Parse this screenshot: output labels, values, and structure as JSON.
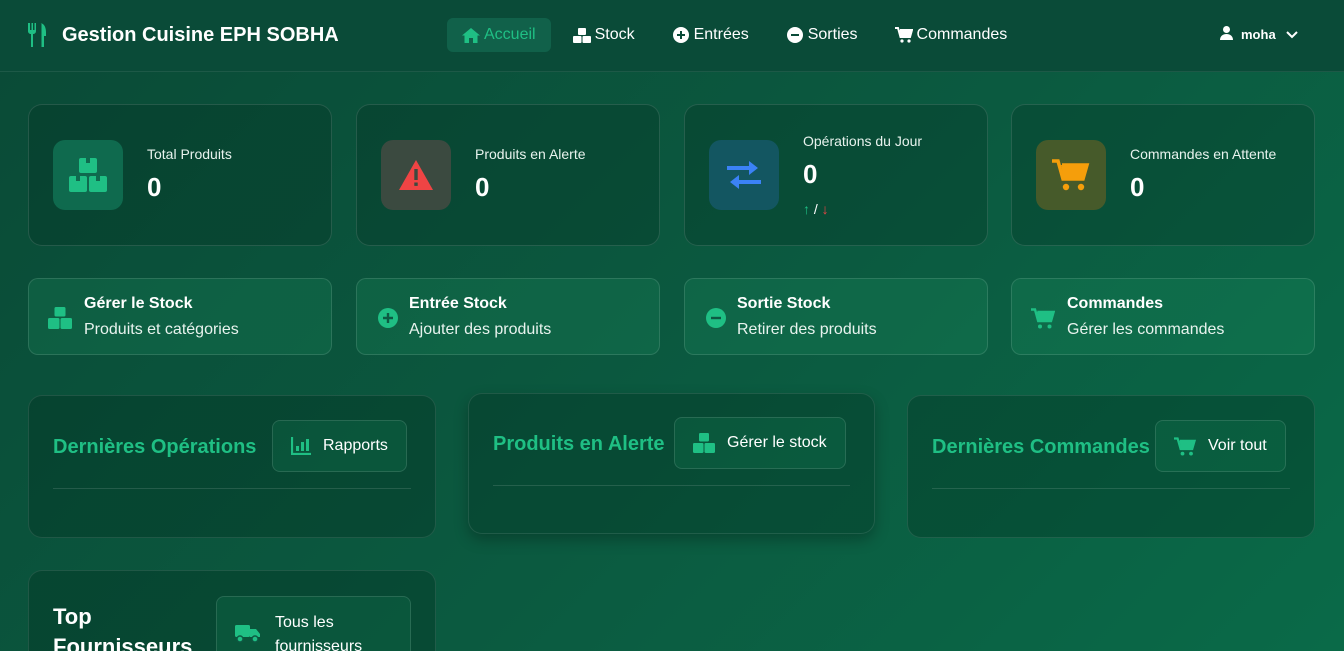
{
  "navbar": {
    "brand_title": "Gestion Cuisine EPH SOBHA",
    "links": [
      {
        "label": "Accueil",
        "icon": "home-icon",
        "active": true
      },
      {
        "label": "Stock",
        "icon": "boxes-icon"
      },
      {
        "label": "Entrées",
        "icon": "plus-circle-icon"
      },
      {
        "label": "Sorties",
        "icon": "minus-circle-icon"
      },
      {
        "label": "Commandes",
        "icon": "cart-icon"
      }
    ],
    "user": {
      "name": "moha",
      "icon": "user-icon"
    }
  },
  "stats": [
    {
      "label": "Total Produits",
      "value": "0",
      "icon": "boxes-icon",
      "color": "#1fbf84"
    },
    {
      "label": "Produits en Alerte",
      "value": "0",
      "icon": "warning-icon",
      "color": "#ef4444"
    },
    {
      "label": "Opérations du Jour",
      "value": "0",
      "icon": "exchange-icon",
      "color": "#3b82f6",
      "sub": {
        "up": "↑",
        "sep": "/",
        "down": "↓"
      }
    },
    {
      "label": "Commandes en Attente",
      "value": "0",
      "icon": "cart-icon",
      "color": "#f59e0b"
    }
  ],
  "quick_actions": [
    {
      "title": "Gérer le Stock",
      "subtitle": "Produits et catégories",
      "icon": "boxes-icon"
    },
    {
      "title": "Entrée Stock",
      "subtitle": "Ajouter des produits",
      "icon": "plus-circle-icon"
    },
    {
      "title": "Sortie Stock",
      "subtitle": "Retirer des produits",
      "icon": "minus-circle-icon"
    },
    {
      "title": "Commandes",
      "subtitle": "Gérer les commandes",
      "icon": "cart-icon"
    }
  ],
  "panels": {
    "operations": {
      "title": "Dernières Opérations",
      "button": "Rapports",
      "icon": "chart-icon"
    },
    "alerts": {
      "title": "Produits en Alerte",
      "button": "Gérer le stock",
      "icon": "boxes-icon"
    },
    "orders": {
      "title": "Dernières Commandes",
      "button": "Voir tout",
      "icon": "cart-icon"
    },
    "suppliers": {
      "title_line1": "Top",
      "title_line2": "Fournisseurs",
      "button_line1": "Tous les",
      "button_line2": "fournisseurs",
      "icon": "truck-icon"
    }
  },
  "colors": {
    "accent": "#1fbf84",
    "background": "#0a5a40",
    "danger": "#ef4444",
    "info": "#3b82f6",
    "warning": "#f59e0b"
  }
}
